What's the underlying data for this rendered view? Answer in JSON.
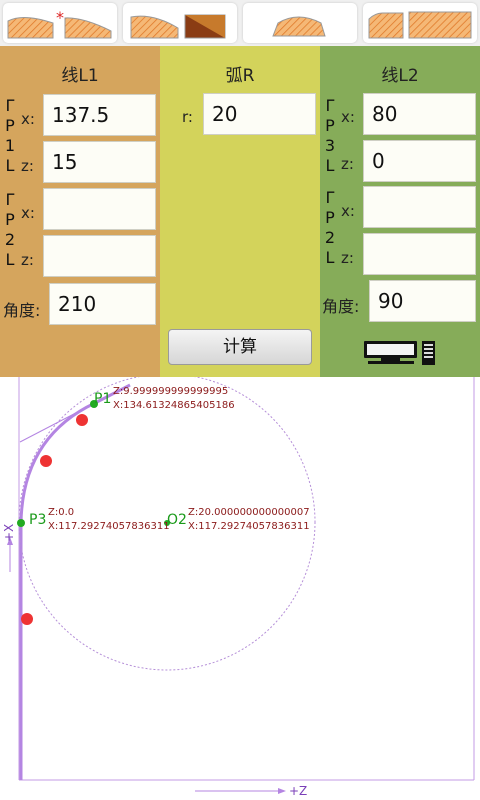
{
  "toolbar": {
    "buttons": [
      {
        "icon": "profile-line-arc-line-icon",
        "selected": true
      },
      {
        "icon": "profile-arc-chamfer-icon"
      },
      {
        "icon": "profile-arc-hump-icon"
      },
      {
        "icon": "profile-step-arc-icon"
      }
    ],
    "marker": "*"
  },
  "panel_l1": {
    "title": "线L1",
    "p1_label": [
      "Γ",
      "P",
      "1",
      "L"
    ],
    "p2_label": [
      "Γ",
      "P",
      "2",
      "L"
    ],
    "x_label": "x:",
    "z_label": "z:",
    "p1_x": "137.5",
    "p1_z": "15",
    "p2_x": "",
    "p2_z": "",
    "angle_label": "角度:",
    "angle": "210"
  },
  "panel_arc": {
    "title": "弧R",
    "r_label": "r:",
    "r": "20",
    "calc_label": "计算"
  },
  "panel_l2": {
    "title": "线L2",
    "p3_label": [
      "Γ",
      "P",
      "3",
      "L"
    ],
    "p2_label": [
      "Γ",
      "P",
      "2",
      "L"
    ],
    "x_label": "x:",
    "z_label": "z:",
    "p3_x": "80",
    "p3_z": "0",
    "p2_x": "",
    "p2_z": "",
    "angle_label": "角度:",
    "angle": "90",
    "icon": "computer-icon"
  },
  "canvas": {
    "p1_label": "P1",
    "p1_z": "Z:9.999999999999995",
    "p1_x": "X:134.61324865405186",
    "p3_label": "P3",
    "p3_z": "Z:0.0",
    "p3_x": "X:117.29274057836311",
    "o2_label": "O2",
    "o2_z": "Z:20.000000000000007",
    "o2_x": "X:117.29274057836311",
    "x_axis_label": "+X",
    "z_axis_label": "+Z",
    "colors": {
      "profile": "#c39be6",
      "point": "#22aa22",
      "marker": "#ee3333",
      "text": "#8b1a1a"
    }
  }
}
